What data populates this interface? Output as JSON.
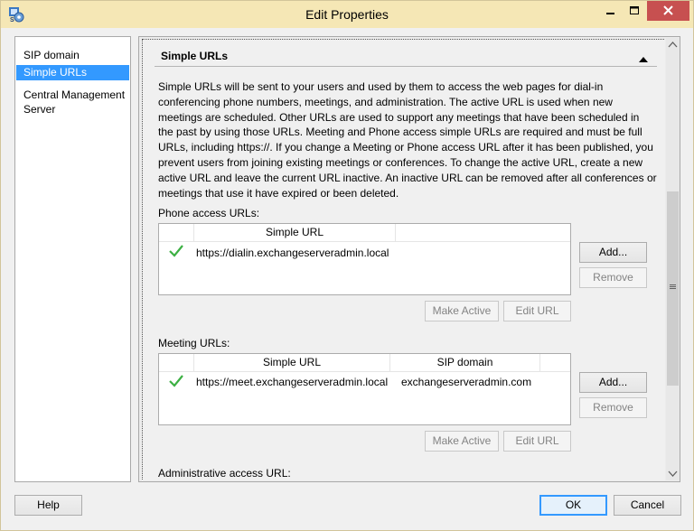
{
  "window": {
    "title": "Edit Properties",
    "icon": "app-settings-icon",
    "accent": "#f5e7b5",
    "close_color": "#c75050"
  },
  "nav": {
    "items": [
      {
        "label": "SIP domain",
        "selected": false
      },
      {
        "label": "Simple URLs",
        "selected": true
      },
      {
        "label": "Central Management Server",
        "selected": false
      }
    ],
    "selected_color": "#3399ff"
  },
  "section": {
    "title": "Simple URLs",
    "description": "Simple URLs will be sent to your users and used by them to access the web pages for dial-in conferencing phone numbers, meetings, and administration. The active URL is used when new meetings are scheduled. Other URLs are used to support any meetings that have been scheduled in the past by using those URLs. Meeting and Phone access simple URLs are required and must be full URLs, including https://. If you change a Meeting or Phone access URL after it has been published, you prevent users from joining existing meetings or conferences. To change the active URL, create a new active URL and leave the current URL inactive. An inactive URL can be removed after all conferences or meetings that use it have expired or been deleted."
  },
  "phone": {
    "label": "Phone access URLs:",
    "columns": [
      "Simple URL",
      ""
    ],
    "rows": [
      {
        "active": true,
        "url": "https://dialin.exchangeserveradmin.local"
      }
    ],
    "add_label": "Add...",
    "remove_label": "Remove",
    "make_active_label": "Make Active",
    "edit_label": "Edit URL"
  },
  "meeting": {
    "label": "Meeting URLs:",
    "columns": [
      "Simple URL",
      "SIP domain",
      ""
    ],
    "rows": [
      {
        "active": true,
        "url": "https://meet.exchangeserveradmin.local",
        "domain": "exchangeserveradmin.com"
      }
    ],
    "add_label": "Add...",
    "remove_label": "Remove",
    "make_active_label": "Make Active",
    "edit_label": "Edit URL"
  },
  "admin": {
    "label": "Administrative access URL:"
  },
  "footer": {
    "help_label": "Help",
    "ok_label": "OK",
    "cancel_label": "Cancel"
  },
  "colors": {
    "check": "#3cb043"
  }
}
